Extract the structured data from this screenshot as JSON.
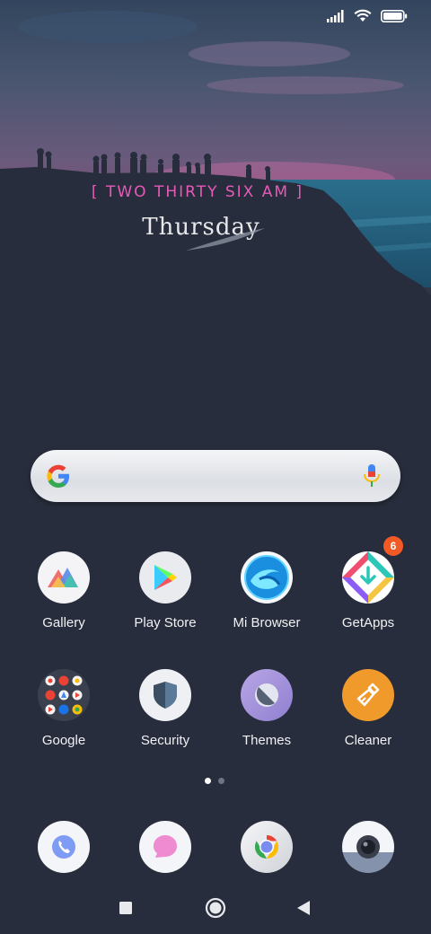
{
  "wallpaper": {
    "clock_text": "[ TWO THIRTY SIX AM ]",
    "day_text": "Thursday"
  },
  "status_icons": [
    "signal-icon",
    "wifi-icon",
    "battery-icon"
  ],
  "search": {
    "logo": "google-g-icon",
    "mic": "microphone-icon"
  },
  "apps_row1": [
    {
      "label": "Gallery",
      "icon": "gallery-icon"
    },
    {
      "label": "Play Store",
      "icon": "play-store-icon"
    },
    {
      "label": "Mi Browser",
      "icon": "mi-browser-icon"
    },
    {
      "label": "GetApps",
      "icon": "getapps-icon",
      "badge": "6"
    }
  ],
  "apps_row2": [
    {
      "label": "Google",
      "icon": "google-folder-icon"
    },
    {
      "label": "Security",
      "icon": "security-shield-icon"
    },
    {
      "label": "Themes",
      "icon": "themes-icon"
    },
    {
      "label": "Cleaner",
      "icon": "cleaner-broom-icon"
    }
  ],
  "page_indicator": {
    "pages": 2,
    "current": 1
  },
  "dock": [
    "phone-icon",
    "messages-icon",
    "chrome-icon",
    "camera-icon"
  ],
  "navbar": [
    "recents-square-icon",
    "home-circle-icon",
    "back-triangle-icon"
  ],
  "colors": {
    "background": "#272d3c",
    "clock_accent": "#e85ab8",
    "badge": "#f15a24"
  }
}
